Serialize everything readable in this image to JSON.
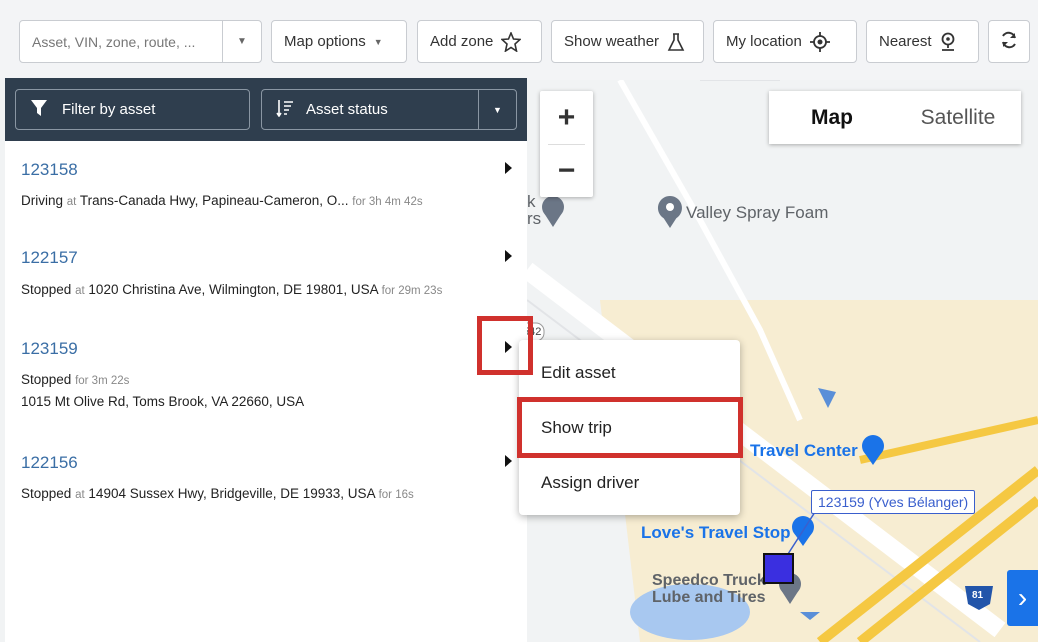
{
  "toolbar": {
    "search_placeholder": "Asset, VIN, zone, route, ...",
    "map_options": "Map options",
    "add_zone": "Add zone",
    "show_weather": "Show weather",
    "my_location": "My location",
    "nearest": "Nearest"
  },
  "panel": {
    "filter_label": "Filter by asset",
    "status_label": "Asset status",
    "assets": [
      {
        "id": "123158",
        "status": "Driving",
        "at": "at",
        "location": "Trans-Canada Hwy, Papineau-Cameron, O...",
        "duration": "for 3h 4m 42s"
      },
      {
        "id": "122157",
        "status": "Stopped",
        "at": "at",
        "location": "1020 Christina Ave, Wilmington, DE 19801, USA",
        "duration": "for 29m 23s"
      },
      {
        "id": "123159",
        "status": "Stopped",
        "duration": "for 3m 22s",
        "location": "1015 Mt Olive Rd, Toms Brook, VA 22660, USA"
      },
      {
        "id": "122156",
        "status": "Stopped",
        "at": "at",
        "location": "14904 Sussex Hwy, Bridgeville, DE 19933, USA",
        "duration": "for 16s"
      }
    ]
  },
  "context_menu": {
    "items": [
      "Edit asset",
      "Show trip",
      "Assign driver"
    ]
  },
  "map": {
    "type_map": "Map",
    "type_satellite": "Satellite",
    "zoom_in": "+",
    "zoom_out": "−",
    "pois": {
      "valley": "Valley Spray Foam",
      "travel_center": "Travel Center",
      "loves": "Love's Travel Stop",
      "speedco_1": "Speedco Truck",
      "speedco_2": "Lube and Tires",
      "route_542": "542",
      "route_81": "81",
      "partial_1": "k",
      "partial_2": "rs"
    },
    "asset_label": "123159 (Yves Bélanger)"
  },
  "colors": {
    "panel_header": "#2f3e4e",
    "asset_id": "#3a6ea5",
    "highlight": "#d0312d",
    "marker": "#3a2fe0",
    "poi_blue": "#1a73e8"
  }
}
